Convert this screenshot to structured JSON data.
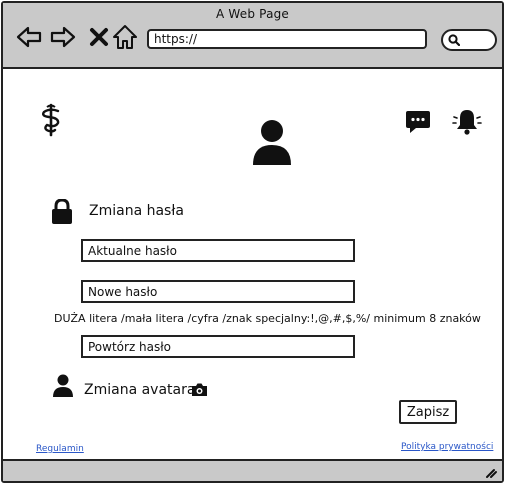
{
  "window": {
    "title": "A Web Page"
  },
  "browser": {
    "url": "https://",
    "nav_icons": [
      "back-arrow-icon",
      "forward-arrow-icon",
      "close-x-icon",
      "home-icon"
    ],
    "search_icon": "search-icon"
  },
  "header": {
    "logo_icon": "caduceus-icon",
    "messages_icon": "chat-bubble-icon",
    "notifications_icon": "bell-icon",
    "avatar_icon": "user-avatar-icon"
  },
  "password_section": {
    "icon": "lock-icon",
    "title": "Zmiana hasła",
    "current_password": {
      "placeholder": "Aktualne hasło",
      "value": ""
    },
    "new_password": {
      "placeholder": "Nowe hasło",
      "value": ""
    },
    "requirements_hint": "DUŻA litera /mała litera /cyfra /znak specjalny:!,@,#,$,%/ minimum 8 znaków",
    "repeat_password": {
      "placeholder": "Powtórz hasło",
      "value": ""
    }
  },
  "avatar_section": {
    "icon": "person-icon",
    "title": "Zmiana avatara",
    "camera_icon": "camera-icon"
  },
  "actions": {
    "save_label": "Zapisz"
  },
  "footer": {
    "terms_link": "Regulamin",
    "privacy_link": "Polityka prywatności"
  }
}
